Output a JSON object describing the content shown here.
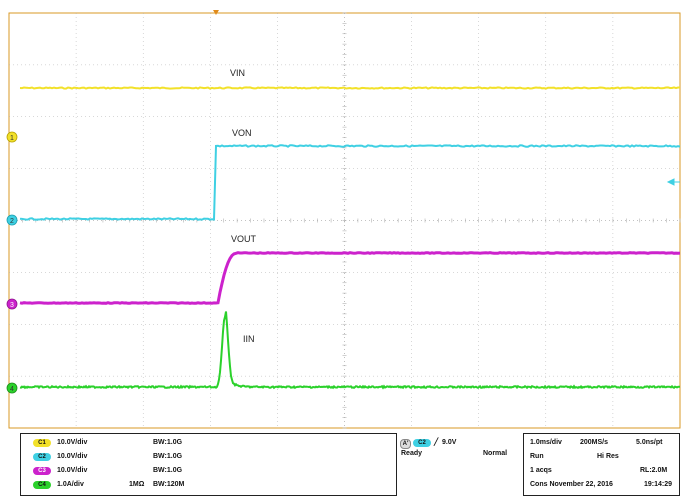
{
  "colors": {
    "ch1": "#f2e12a",
    "ch2": "#3fd0e3",
    "ch3": "#cc22cc",
    "ch4": "#2bd12b",
    "grid": "#b0b0b0",
    "frame": "#d99a26"
  },
  "waveforms": [
    {
      "channel": "1",
      "label": "VIN"
    },
    {
      "channel": "2",
      "label": "VON"
    },
    {
      "channel": "3",
      "label": "VOUT"
    },
    {
      "channel": "4",
      "label": "IIN"
    }
  ],
  "channels": [
    {
      "id": "C1",
      "scale": "10.0V/div",
      "coupling": "",
      "bw": "BW:1.0G"
    },
    {
      "id": "C2",
      "scale": "10.0V/div",
      "coupling": "",
      "bw": "BW:1.0G"
    },
    {
      "id": "C3",
      "scale": "10.0V/div",
      "coupling": "",
      "bw": "BW:1.0G"
    },
    {
      "id": "C4",
      "scale": "1.0A/div",
      "coupling": "1MΩ",
      "bw": "BW:120M"
    }
  ],
  "trigger": {
    "source": "C2",
    "slope_icon": "rising-edge-icon",
    "level": "9.0V",
    "state": "Ready",
    "mode": "Normal"
  },
  "timebase": {
    "scale": "1.0ms/div",
    "sample_rate": "200MS/s",
    "resolution": "5.0ns/pt",
    "run_state": "Run",
    "acq_mode": "Hi Res",
    "acqs": "1 acqs",
    "record_length": "RL:2.0M",
    "date_line": "Cons  November 22, 2016",
    "time": "19:14:29"
  }
}
